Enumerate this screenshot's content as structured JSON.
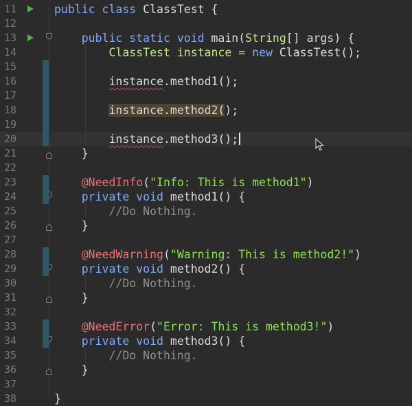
{
  "editor": {
    "lines": [
      {
        "num": "11",
        "tokens": [
          {
            "t": "public ",
            "c": "kw"
          },
          {
            "t": "class ",
            "c": "kw"
          },
          {
            "t": "ClassTest {",
            "c": "plain"
          }
        ]
      },
      {
        "num": "12",
        "tokens": []
      },
      {
        "num": "13",
        "tokens": [
          {
            "t": "    public ",
            "c": "kw"
          },
          {
            "t": "static ",
            "c": "kw"
          },
          {
            "t": "void ",
            "c": "kw"
          },
          {
            "t": "main(",
            "c": "plain"
          },
          {
            "t": "String",
            "c": "type"
          },
          {
            "t": "[] args) {",
            "c": "plain"
          }
        ]
      },
      {
        "num": "14",
        "tokens": [
          {
            "t": "        ",
            "c": "plain"
          },
          {
            "t": "ClassTest",
            "c": "type"
          },
          {
            "t": " instance = ",
            "c": "type"
          },
          {
            "t": "new ",
            "c": "kw"
          },
          {
            "t": "ClassTest();",
            "c": "plain"
          }
        ]
      },
      {
        "num": "15",
        "tokens": []
      },
      {
        "num": "16",
        "tokens": [
          {
            "t": "        ",
            "c": "plain"
          },
          {
            "t": "instance",
            "c": "plain",
            "squiggle": true
          },
          {
            "t": ".method1();",
            "c": "plain"
          }
        ]
      },
      {
        "num": "17",
        "tokens": []
      },
      {
        "num": "18",
        "tokens": [
          {
            "t": "        ",
            "c": "plain"
          },
          {
            "t": "instance.method2(",
            "c": "plain",
            "hl": true
          },
          {
            "t": ")",
            "c": "plain"
          },
          {
            "t": ";",
            "c": "plain"
          }
        ]
      },
      {
        "num": "19",
        "tokens": []
      },
      {
        "num": "20",
        "tokens": [
          {
            "t": "        ",
            "c": "plain"
          },
          {
            "t": "instance",
            "c": "plain",
            "squiggle": true
          },
          {
            "t": ".method3();",
            "c": "plain"
          }
        ],
        "caret": true
      },
      {
        "num": "21",
        "tokens": [
          {
            "t": "    }",
            "c": "plain"
          }
        ]
      },
      {
        "num": "22",
        "tokens": []
      },
      {
        "num": "23",
        "tokens": [
          {
            "t": "    ",
            "c": "plain"
          },
          {
            "t": "@NeedInfo",
            "c": "anno"
          },
          {
            "t": "(",
            "c": "plain"
          },
          {
            "t": "\"Info: This is method1\"",
            "c": "str"
          },
          {
            "t": ")",
            "c": "plain"
          }
        ]
      },
      {
        "num": "24",
        "tokens": [
          {
            "t": "    private ",
            "c": "kw"
          },
          {
            "t": "void ",
            "c": "kw"
          },
          {
            "t": "method1() {",
            "c": "plain"
          }
        ]
      },
      {
        "num": "25",
        "tokens": [
          {
            "t": "        //Do Nothing.",
            "c": "cmt"
          }
        ]
      },
      {
        "num": "26",
        "tokens": [
          {
            "t": "    }",
            "c": "plain"
          }
        ]
      },
      {
        "num": "27",
        "tokens": []
      },
      {
        "num": "28",
        "tokens": [
          {
            "t": "    ",
            "c": "plain"
          },
          {
            "t": "@NeedWarning",
            "c": "anno"
          },
          {
            "t": "(",
            "c": "plain"
          },
          {
            "t": "\"Warning: This is method2!\"",
            "c": "str"
          },
          {
            "t": ")",
            "c": "plain"
          }
        ]
      },
      {
        "num": "29",
        "tokens": [
          {
            "t": "    private ",
            "c": "kw"
          },
          {
            "t": "void ",
            "c": "kw"
          },
          {
            "t": "method2() {",
            "c": "plain"
          }
        ]
      },
      {
        "num": "30",
        "tokens": [
          {
            "t": "        //Do Nothing.",
            "c": "cmt"
          }
        ]
      },
      {
        "num": "31",
        "tokens": [
          {
            "t": "    }",
            "c": "plain"
          }
        ]
      },
      {
        "num": "32",
        "tokens": []
      },
      {
        "num": "33",
        "tokens": [
          {
            "t": "    ",
            "c": "plain"
          },
          {
            "t": "@NeedError",
            "c": "anno"
          },
          {
            "t": "(",
            "c": "plain"
          },
          {
            "t": "\"Error: This is method3!\"",
            "c": "str"
          },
          {
            "t": ")",
            "c": "plain"
          }
        ]
      },
      {
        "num": "34",
        "tokens": [
          {
            "t": "    private ",
            "c": "kw"
          },
          {
            "t": "void ",
            "c": "kw"
          },
          {
            "t": "method3() {",
            "c": "plain"
          }
        ]
      },
      {
        "num": "35",
        "tokens": [
          {
            "t": "        //Do Nothing.",
            "c": "cmt"
          }
        ]
      },
      {
        "num": "36",
        "tokens": [
          {
            "t": "    }",
            "c": "plain"
          }
        ]
      },
      {
        "num": "37",
        "tokens": []
      },
      {
        "num": "38",
        "tokens": [
          {
            "t": "}",
            "c": "plain"
          }
        ]
      }
    ],
    "run_icon_lines": [
      "11",
      "13"
    ],
    "current_line": "20",
    "colors": {
      "background": "#2b2b2b",
      "keyword": "#82aaff",
      "annotation": "#ef6f74",
      "string": "#8ee24f",
      "comment": "#8f8f8f",
      "run_icon": "#4fb548",
      "change_marker": "#2f5866"
    }
  }
}
